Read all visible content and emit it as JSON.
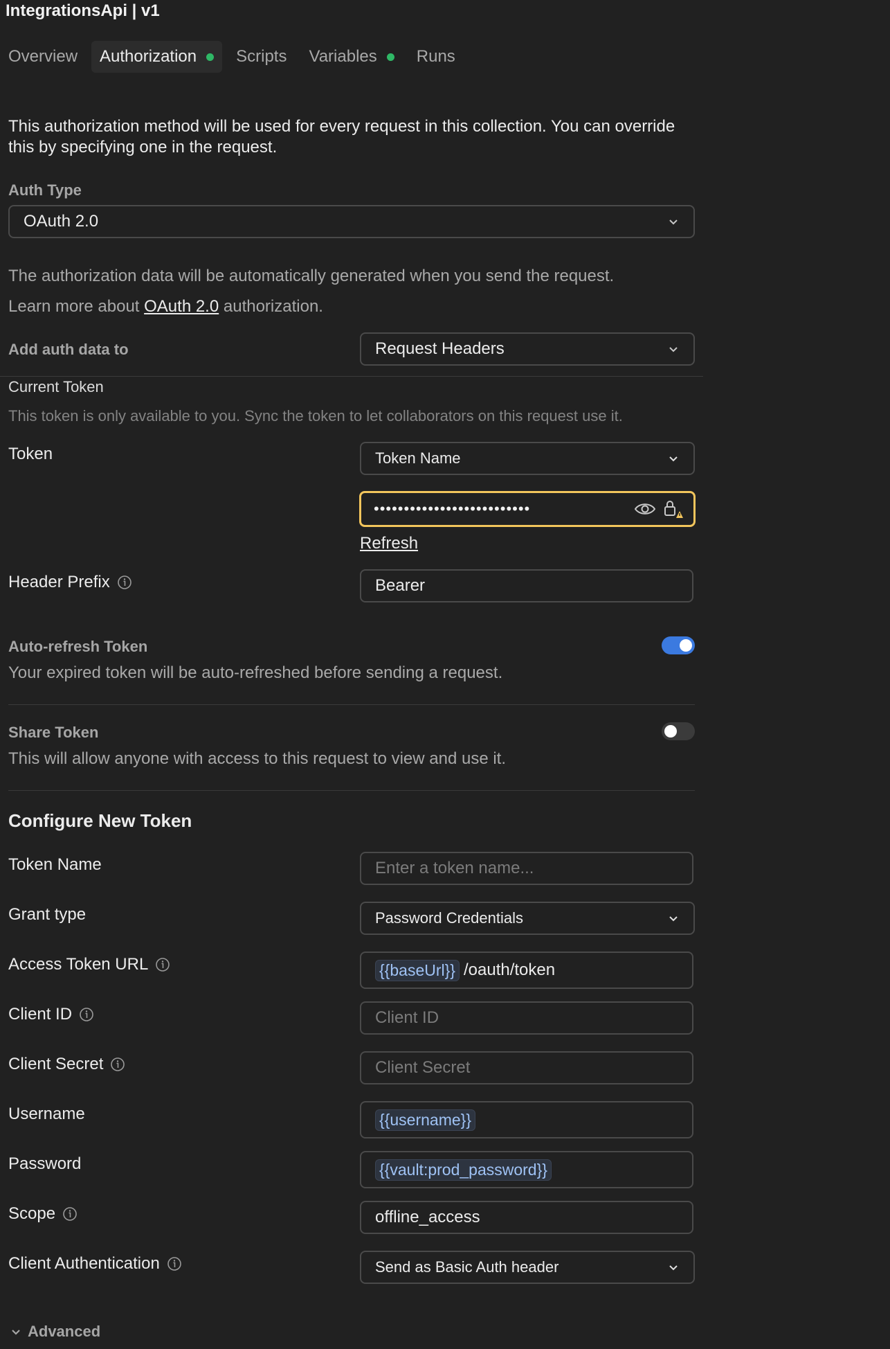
{
  "title": "IntegrationsApi | v1",
  "tabs": [
    {
      "label": "Overview"
    },
    {
      "label": "Authorization"
    },
    {
      "label": "Scripts"
    },
    {
      "label": "Variables"
    },
    {
      "label": "Runs"
    }
  ],
  "intro": "This authorization method will be used for every request in this collection. You can override this by specifying one in the request.",
  "auth_type": {
    "label": "Auth Type",
    "value": "OAuth 2.0"
  },
  "auto_note": "The authorization data will be automatically generated when you send the request.",
  "learn": {
    "prefix": "Learn more about ",
    "link": "OAuth 2.0",
    "suffix": " authorization."
  },
  "add_auth": {
    "label": "Add auth data to",
    "value": "Request Headers"
  },
  "current_token": {
    "heading": "Current Token",
    "note": "This token is only available to you. Sync the token to let collaborators on this request use it.",
    "token_label": "Token",
    "token_select": "Token Name",
    "token_masked": "••••••••••••••••••••••••••",
    "refresh": "Refresh",
    "header_prefix_label": "Header Prefix",
    "header_prefix_value": "Bearer"
  },
  "auto_refresh": {
    "label": "Auto-refresh Token",
    "desc": "Your expired token will be auto-refreshed before sending a request.",
    "enabled": true
  },
  "share_token": {
    "label": "Share Token",
    "desc": "This will allow anyone with access to this request to view and use it.",
    "enabled": false
  },
  "configure": {
    "heading": "Configure New Token",
    "token_name": {
      "label": "Token Name",
      "placeholder": "Enter a token name..."
    },
    "grant_type": {
      "label": "Grant type",
      "value": "Password Credentials"
    },
    "access_token_url": {
      "label": "Access Token URL",
      "var": "{{baseUrl}}",
      "rest": "/oauth/token"
    },
    "client_id": {
      "label": "Client ID",
      "placeholder": "Client ID"
    },
    "client_secret": {
      "label": "Client Secret",
      "placeholder": "Client Secret"
    },
    "username": {
      "label": "Username",
      "var": "{{username}}"
    },
    "password": {
      "label": "Password",
      "var": "{{vault:prod_password}}"
    },
    "scope": {
      "label": "Scope",
      "value": "offline_access"
    },
    "client_auth": {
      "label": "Client Authentication",
      "value": "Send as Basic Auth header"
    }
  },
  "advanced": "Advanced",
  "colors": {
    "accent": "#3b7ae0",
    "focus": "#f2c55c",
    "status_dot": "#2fb866",
    "variable": "#9fc2f4"
  }
}
